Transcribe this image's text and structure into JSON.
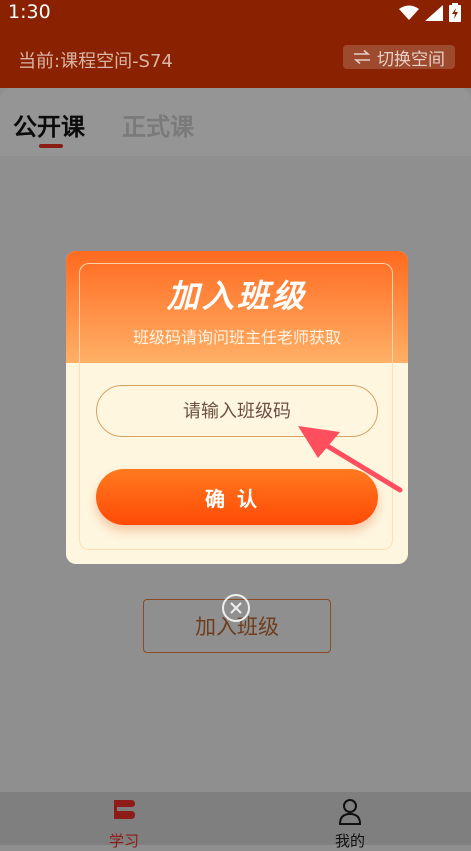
{
  "status_bar": {
    "time": "1:30"
  },
  "header": {
    "current_space": "当前:课程空间-S74",
    "switch_label": "切换空间"
  },
  "tabs": [
    {
      "label": "公开课",
      "active": true
    },
    {
      "label": "正式课",
      "active": false
    }
  ],
  "background": {
    "join_button_label": "加入班级"
  },
  "modal": {
    "title": "加入班级",
    "subtitle": "班级码请询问班主任老师获取",
    "input_placeholder": "请输入班级码",
    "confirm_label": "确认"
  },
  "bottom_nav": [
    {
      "label": "学习",
      "icon": "book-icon",
      "active": true
    },
    {
      "label": "我的",
      "icon": "person-icon",
      "active": false
    }
  ],
  "colors": {
    "header_bg": "#8a2100",
    "accent": "#ff5a10",
    "active_tab": "#8d1b17"
  }
}
